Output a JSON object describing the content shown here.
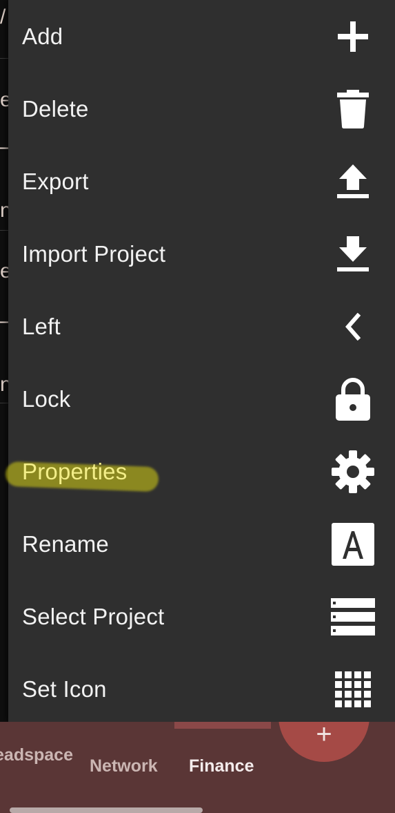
{
  "background_fragments": [
    "/",
    "e",
    "–",
    "n",
    "e",
    "–",
    "n"
  ],
  "menu": {
    "items": [
      {
        "label": "Add",
        "icon": "plus-icon"
      },
      {
        "label": "Delete",
        "icon": "trash-icon"
      },
      {
        "label": "Export",
        "icon": "upload-icon"
      },
      {
        "label": "Import Project",
        "icon": "download-icon"
      },
      {
        "label": "Left",
        "icon": "chevron-left-icon"
      },
      {
        "label": "Lock",
        "icon": "lock-icon"
      },
      {
        "label": "Properties",
        "icon": "gear-icon",
        "highlighted": true
      },
      {
        "label": "Rename",
        "icon": "text-a-icon"
      },
      {
        "label": "Select Project",
        "icon": "list-icon"
      },
      {
        "label": "Set Icon",
        "icon": "grid-icon"
      }
    ],
    "highlight_color": "#d7d214"
  },
  "bottom_nav": {
    "items": [
      {
        "label": "eadspace"
      },
      {
        "label": "Network"
      },
      {
        "label": "Finance",
        "active": true
      }
    ],
    "fab_label": "+",
    "accent": "#a54a46",
    "bar_color": "#5a3636"
  }
}
